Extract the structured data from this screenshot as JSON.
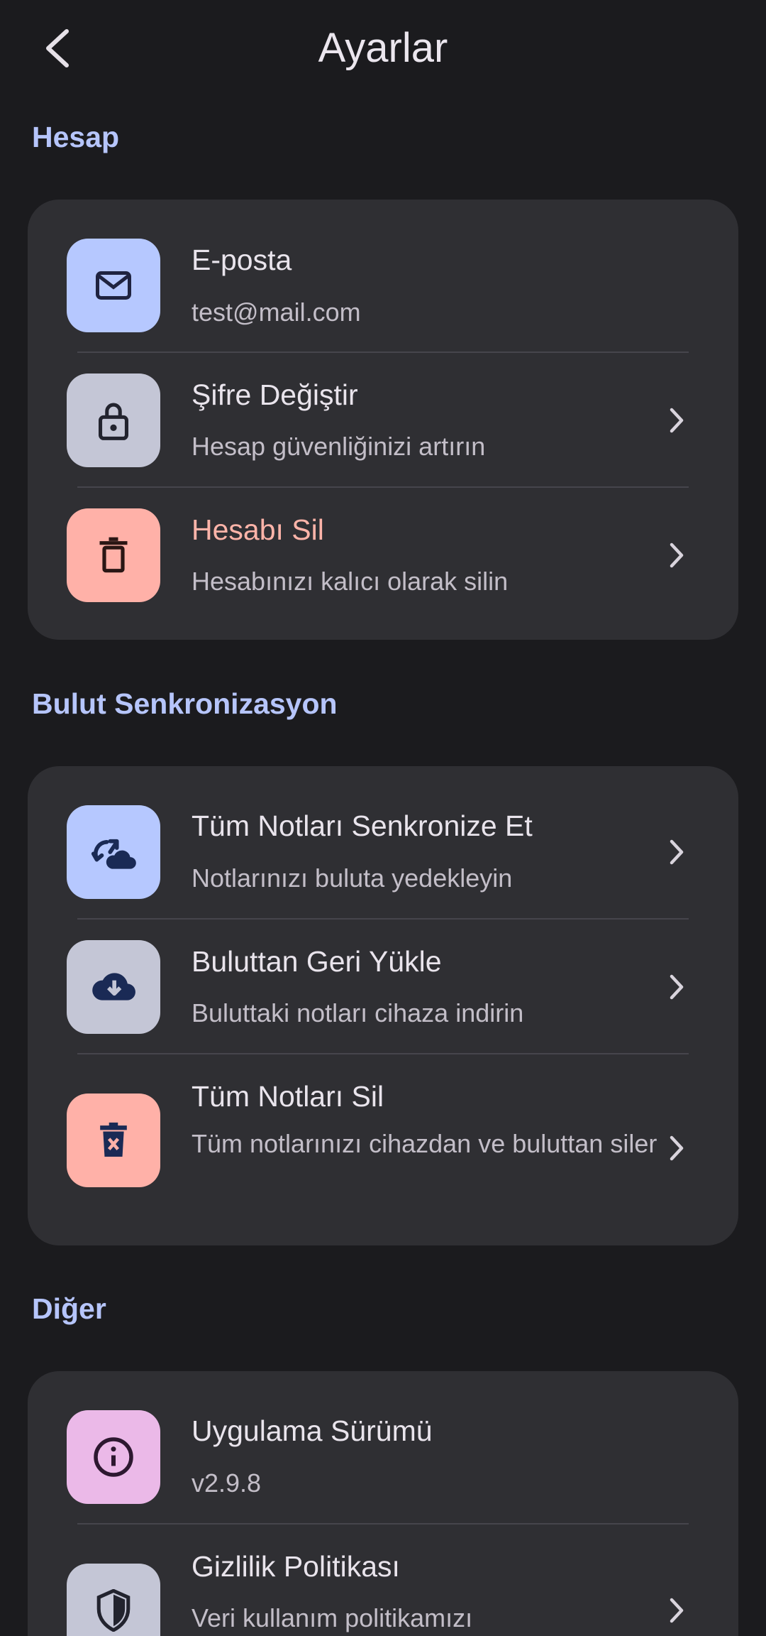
{
  "header": {
    "title": "Ayarlar"
  },
  "colors": {
    "background": "#1b1b1e",
    "card": "#2f2f33",
    "section_title": "#b6c5fb",
    "danger_text": "#ffb4a9",
    "tile_blue": "#b6c8ff",
    "tile_gray": "#c4c6d6",
    "tile_red": "#ffb1a8",
    "tile_pink": "#ebb9e8"
  },
  "sections": [
    {
      "title": "Hesap",
      "items": [
        {
          "icon": "mail-icon",
          "title": "E-posta",
          "subtitle": "test@mail.com",
          "chevron": false
        },
        {
          "icon": "lock-icon",
          "title": "Şifre Değiştir",
          "subtitle": "Hesap güvenliğinizi artırın",
          "chevron": true
        },
        {
          "icon": "trash-icon",
          "title": "Hesabı Sil",
          "subtitle": "Hesabınızı kalıcı olarak silin",
          "chevron": true,
          "danger": true
        }
      ]
    },
    {
      "title": "Bulut Senkronizasyon",
      "items": [
        {
          "icon": "cloud-sync-icon",
          "title": "Tüm Notları Senkronize Et",
          "subtitle": "Notlarınızı buluta yedekleyin",
          "chevron": true
        },
        {
          "icon": "cloud-download-icon",
          "title": "Buluttan Geri Yükle",
          "subtitle": "Buluttaki notları cihaza indirin",
          "chevron": true
        },
        {
          "icon": "delete-forever-icon",
          "title": "Tüm Notları Sil",
          "subtitle": "Tüm notlarınızı cihazdan ve buluttan siler",
          "chevron": true
        }
      ]
    },
    {
      "title": "Diğer",
      "items": [
        {
          "icon": "info-icon",
          "title": "Uygulama Sürümü",
          "subtitle": "v2.9.8",
          "chevron": false
        },
        {
          "icon": "shield-icon",
          "title": "Gizlilik Politikası",
          "subtitle": "Veri kullanım politikamızı",
          "chevron": true
        }
      ]
    }
  ]
}
